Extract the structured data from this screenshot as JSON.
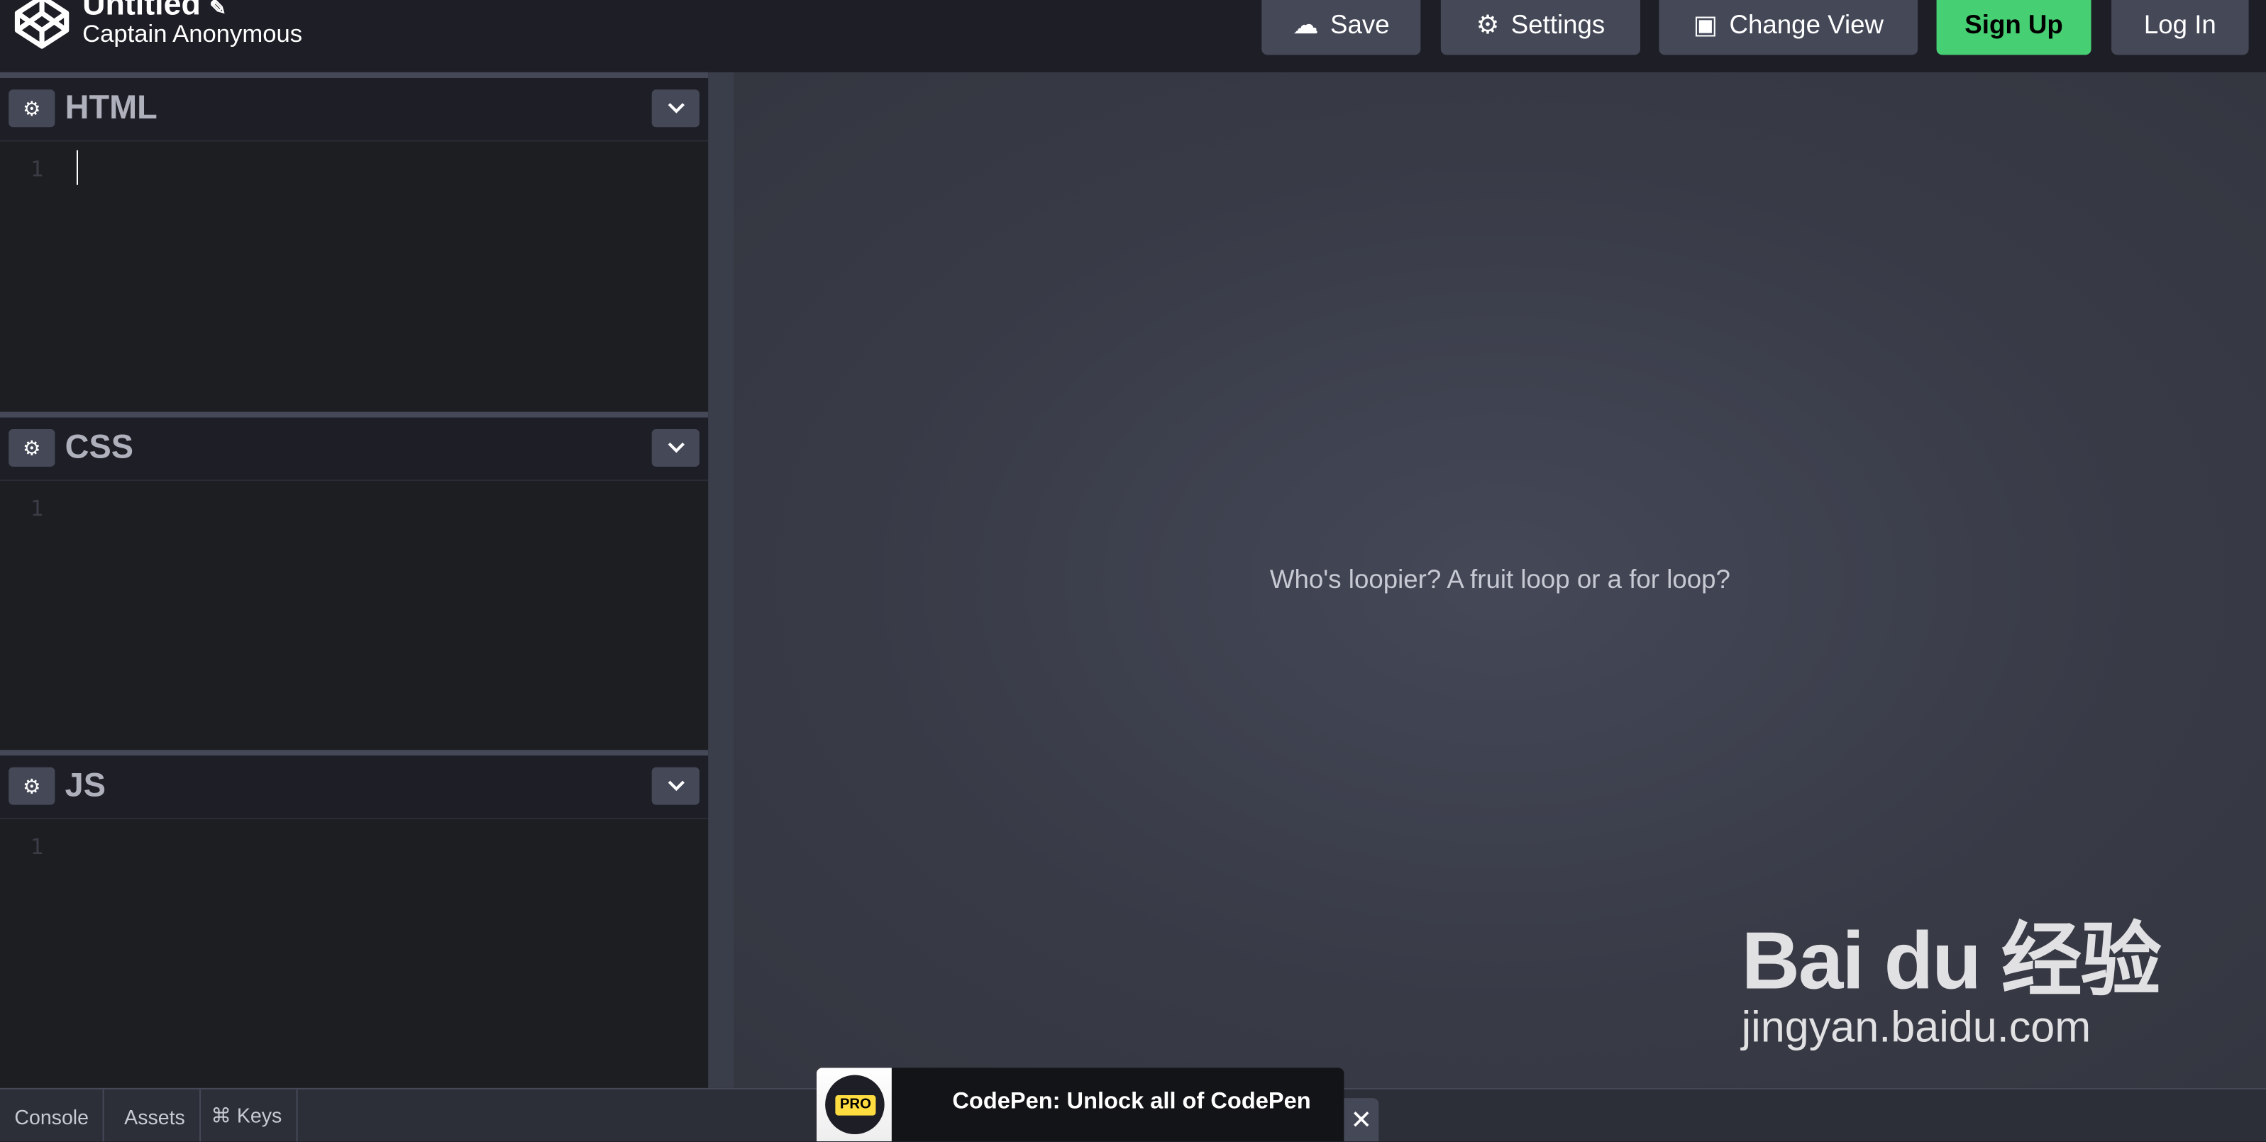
{
  "header": {
    "title": "Untitled",
    "edit_icon": "pencil-icon",
    "author": "Captain Anonymous",
    "buttons": {
      "save": "Save",
      "settings": "Settings",
      "change_view": "Change View",
      "sign_up": "Sign Up",
      "log_in": "Log In"
    }
  },
  "editors": [
    {
      "name": "HTML",
      "line": "1"
    },
    {
      "name": "CSS",
      "line": "1"
    },
    {
      "name": "JS",
      "line": "1"
    }
  ],
  "preview": {
    "text": "Who's loopier? A fruit loop or a for loop?"
  },
  "footer": {
    "tabs": [
      "Console",
      "Assets",
      "⌘ Keys"
    ]
  },
  "promo": {
    "badge": "PRO",
    "text": "CodePen: Unlock all of CodePen",
    "close": "✕"
  },
  "watermark": {
    "line1": "Bai du 经验",
    "line2": "jingyan.baidu.com"
  },
  "colors": {
    "accent_green": "#47cf73",
    "button_bg": "#444857",
    "pro_yellow": "#ffdd40"
  }
}
